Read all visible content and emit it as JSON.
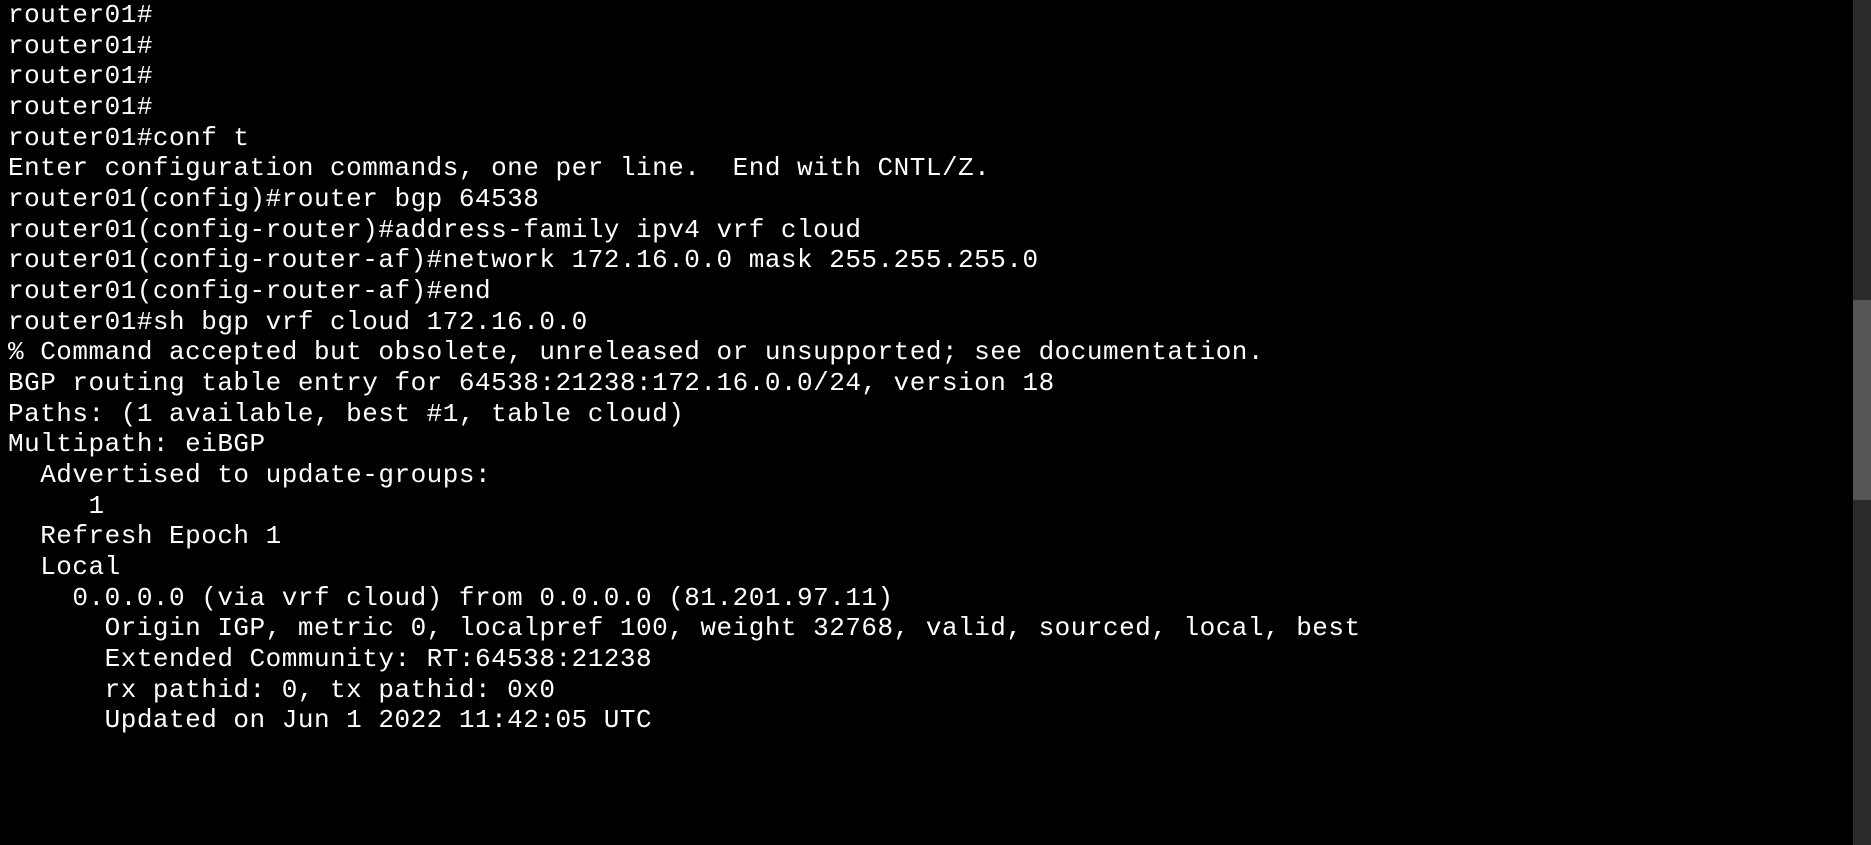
{
  "terminal": {
    "lines": [
      "router01#",
      "router01#",
      "router01#",
      "router01#",
      "router01#conf t",
      "Enter configuration commands, one per line.  End with CNTL/Z.",
      "router01(config)#router bgp 64538",
      "router01(config-router)#address-family ipv4 vrf cloud",
      "router01(config-router-af)#network 172.16.0.0 mask 255.255.255.0",
      "router01(config-router-af)#end",
      "router01#sh bgp vrf cloud 172.16.0.0",
      "% Command accepted but obsolete, unreleased or unsupported; see documentation.",
      "BGP routing table entry for 64538:21238:172.16.0.0/24, version 18",
      "Paths: (1 available, best #1, table cloud)",
      "Multipath: eiBGP",
      "  Advertised to update-groups:",
      "     1",
      "  Refresh Epoch 1",
      "  Local",
      "    0.0.0.0 (via vrf cloud) from 0.0.0.0 (81.201.97.11)",
      "      Origin IGP, metric 0, localpref 100, weight 32768, valid, sourced, local, best",
      "      Extended Community: RT:64538:21238",
      "      rx pathid: 0, tx pathid: 0x0",
      "      Updated on Jun 1 2022 11:42:05 UTC"
    ]
  }
}
